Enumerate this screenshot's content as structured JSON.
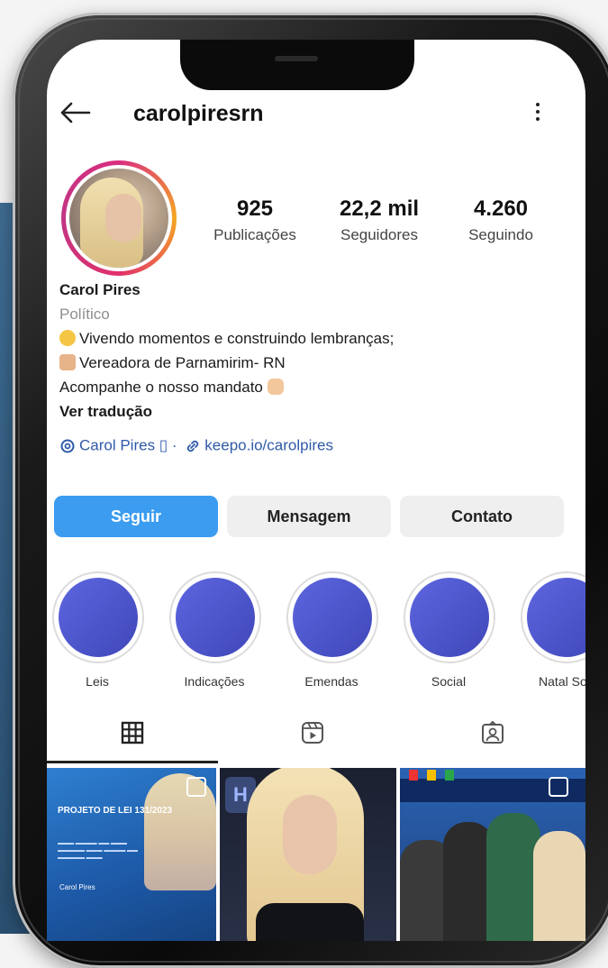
{
  "header": {
    "username": "carolpiresrn"
  },
  "stats": [
    {
      "value": "925",
      "label": "Publicações"
    },
    {
      "value": "22,2 mil",
      "label": "Seguidores"
    },
    {
      "value": "4.260",
      "label": "Seguindo"
    }
  ],
  "bio": {
    "name": "Carol Pires",
    "category": "Político",
    "line1": "Vivendo momentos e construindo lembranças;",
    "line2": "Vereadora de Parnamirim- RN",
    "line3": "Acompanhe o nosso mandato",
    "translate": "Ver tradução"
  },
  "links": {
    "threads": "Carol Pires ▯",
    "sep": " · ",
    "url": "keepo.io/carolpires"
  },
  "buttons": {
    "follow": "Seguir",
    "message": "Mensagem",
    "contact": "Contato"
  },
  "highlights": [
    "Leis",
    "Indicações",
    "Emendas",
    "Social",
    "Natal Soli"
  ],
  "posts": {
    "post1_title": "PROJETO DE LEI 131/2023",
    "post1_logo": "Carol Pires"
  },
  "colors": {
    "accent": "#3b9cf0",
    "link": "#2f5aa8",
    "highlight": "#4f57cf"
  },
  "icons": {
    "back": "arrow-left-icon",
    "more": "more-vertical-icon",
    "grid": "grid-icon",
    "reels": "reels-icon",
    "tagged": "tagged-icon"
  }
}
